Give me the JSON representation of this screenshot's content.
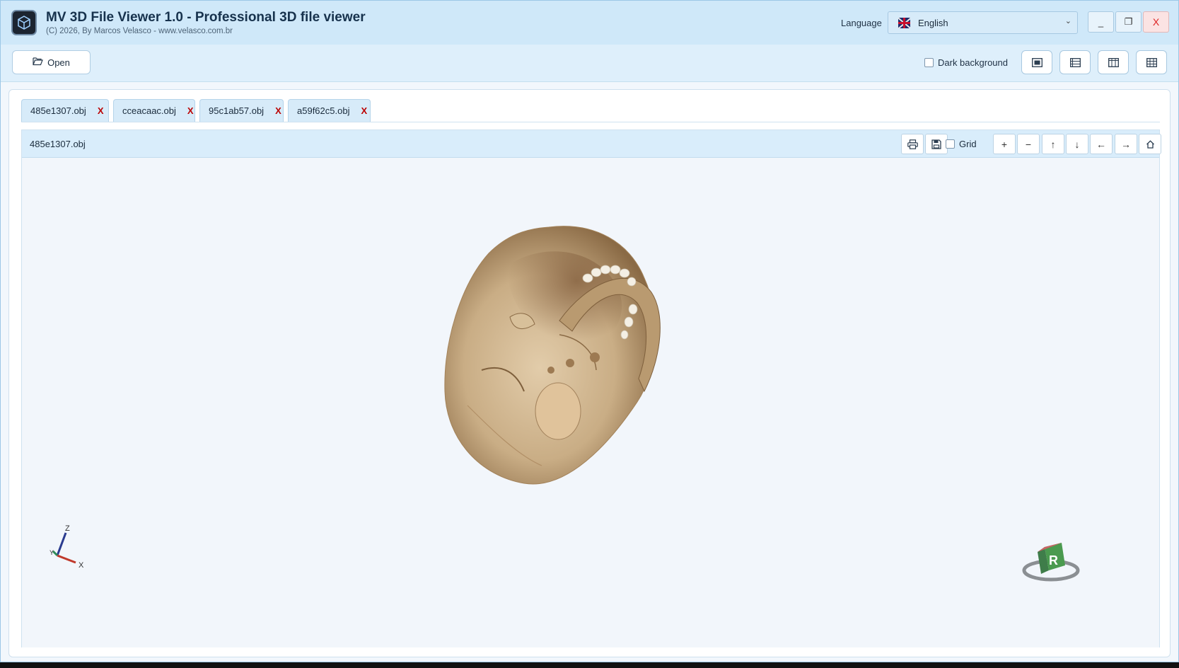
{
  "window": {
    "title": "MV 3D File Viewer 1.0 - Professional 3D file viewer",
    "subtitle": "(C) 2026, By Marcos Velasco - www.velasco.com.br",
    "icon": "app-cube-icon",
    "minimize_label": "_",
    "restore_label": "❐",
    "close_label": "X"
  },
  "language": {
    "label": "Language",
    "selected": "English",
    "flag_icon": "uk-flag-icon"
  },
  "toolbar": {
    "open_label": "Open",
    "dark_background_label": "Dark background",
    "dark_background_checked": false,
    "layout_buttons": [
      "single-view-icon",
      "rows-view-icon",
      "columns-view-icon",
      "grid-view-icon"
    ]
  },
  "tabs": [
    {
      "label": "485e1307.obj",
      "close": "X",
      "active": true
    },
    {
      "label": "cceacaac.obj",
      "close": "X",
      "active": false
    },
    {
      "label": "95c1ab57.obj",
      "close": "X",
      "active": false
    },
    {
      "label": "a59f62c5.obj",
      "close": "X",
      "active": false
    }
  ],
  "viewer": {
    "filename": "485e1307.obj",
    "grid_label": "Grid",
    "grid_checked": false,
    "zoom_in": "+",
    "zoom_out": "−",
    "move_up": "↑",
    "move_down": "↓",
    "move_left": "←",
    "move_right": "→",
    "axis": {
      "z": "Z",
      "x": "X",
      "y": "Y"
    },
    "orientation_cube_label": "R",
    "colors": {
      "model_bone": "#c9ad85",
      "model_shadow": "#8a6a45",
      "axis_x": "#c0392b",
      "axis_y": "#2e8b57",
      "axis_z": "#2a3b8f"
    }
  }
}
